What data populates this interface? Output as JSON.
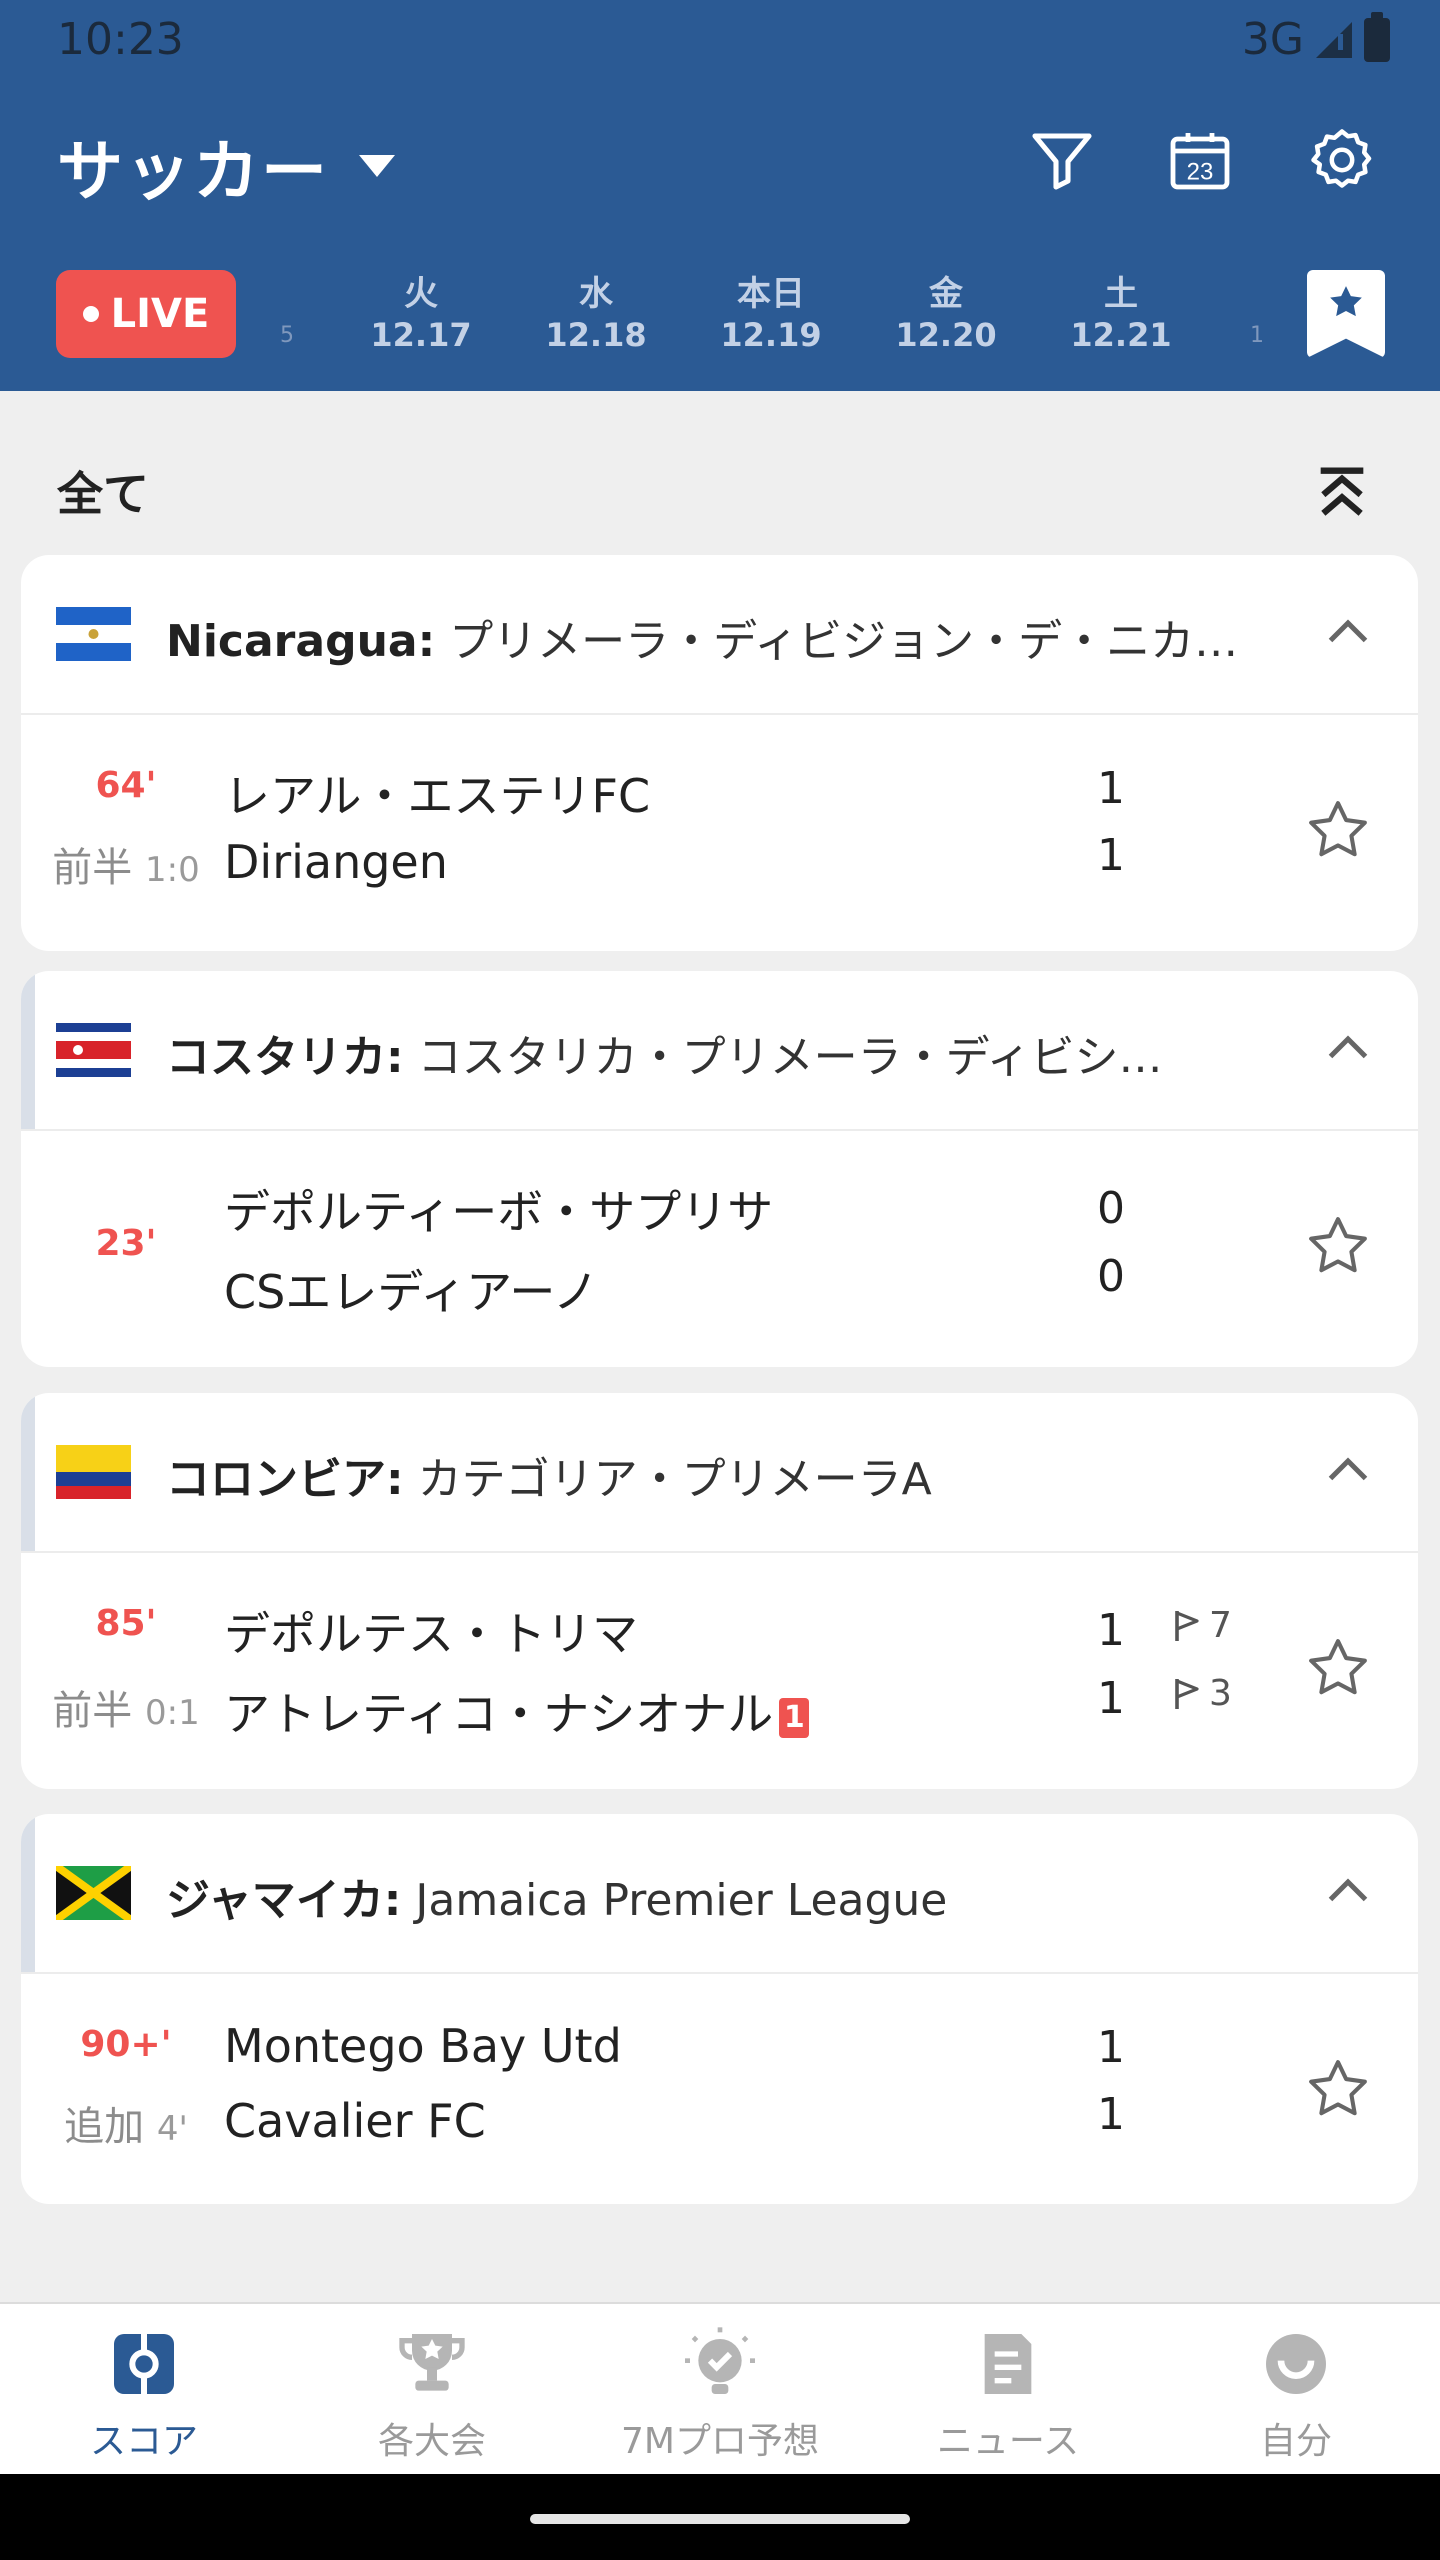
{
  "status_bar": {
    "time": "10:23",
    "network": "3G"
  },
  "header": {
    "title": "サッカー",
    "icons": [
      "filter-icon",
      "calendar-icon",
      "settings-icon"
    ],
    "calendar_day": "23"
  },
  "date_tabs": {
    "live_label": "LIVE",
    "dates": [
      {
        "dow": "火",
        "md": "12.17"
      },
      {
        "dow": "水",
        "md": "12.18"
      },
      {
        "dow": "本日",
        "md": "12.19"
      },
      {
        "dow": "金",
        "md": "12.20"
      },
      {
        "dow": "土",
        "md": "12.21"
      }
    ],
    "edge_left": "5",
    "edge_right": "1"
  },
  "section": {
    "title": "全て"
  },
  "leagues": [
    {
      "country": "Nicaragua:",
      "name": "プリメーラ・ディビジョン・デ・ニカ…",
      "match": {
        "minute": "64'",
        "period": "前半",
        "ht_score": "1:0",
        "home": "レアル・エステリFC",
        "away": "Diriangen",
        "home_score": "1",
        "away_score": "1"
      }
    },
    {
      "country": "コスタリカ:",
      "name": "コスタリカ・プリメーラ・ディビシ…",
      "match": {
        "minute": "23'",
        "home": "デポルティーボ・サプリサ",
        "away": "CSエレディアーノ",
        "home_score": "0",
        "away_score": "0"
      }
    },
    {
      "country": "コロンビア:",
      "name": "カテゴリア・プリメーラA",
      "match": {
        "minute": "85'",
        "period": "前半",
        "ht_score": "0:1",
        "home": "デポルテス・トリマ",
        "away": "アトレティコ・ナシオナル",
        "away_red_cards": "1",
        "home_score": "1",
        "away_score": "1",
        "home_corners": "7",
        "away_corners": "3"
      }
    },
    {
      "country": "ジャマイカ:",
      "name": "Jamaica Premier League",
      "match": {
        "minute": "90+'",
        "period": "追加",
        "ht_score": "4'",
        "home": "Montego Bay Utd",
        "away": "Cavalier FC",
        "home_score": "1",
        "away_score": "1"
      }
    }
  ],
  "bottom_nav": [
    {
      "label": "スコア",
      "icon": "score-icon",
      "active": true
    },
    {
      "label": "各大会",
      "icon": "trophy-icon",
      "active": false
    },
    {
      "label": "7Mプロ予想",
      "icon": "prediction-icon",
      "active": false
    },
    {
      "label": "ニュース",
      "icon": "news-icon",
      "active": false
    },
    {
      "label": "自分",
      "icon": "profile-icon",
      "active": false
    }
  ],
  "colors": {
    "header": "#2b5a94",
    "live": "#ef5350",
    "minute": "#ef5350",
    "active_nav": "#2b5a94"
  }
}
